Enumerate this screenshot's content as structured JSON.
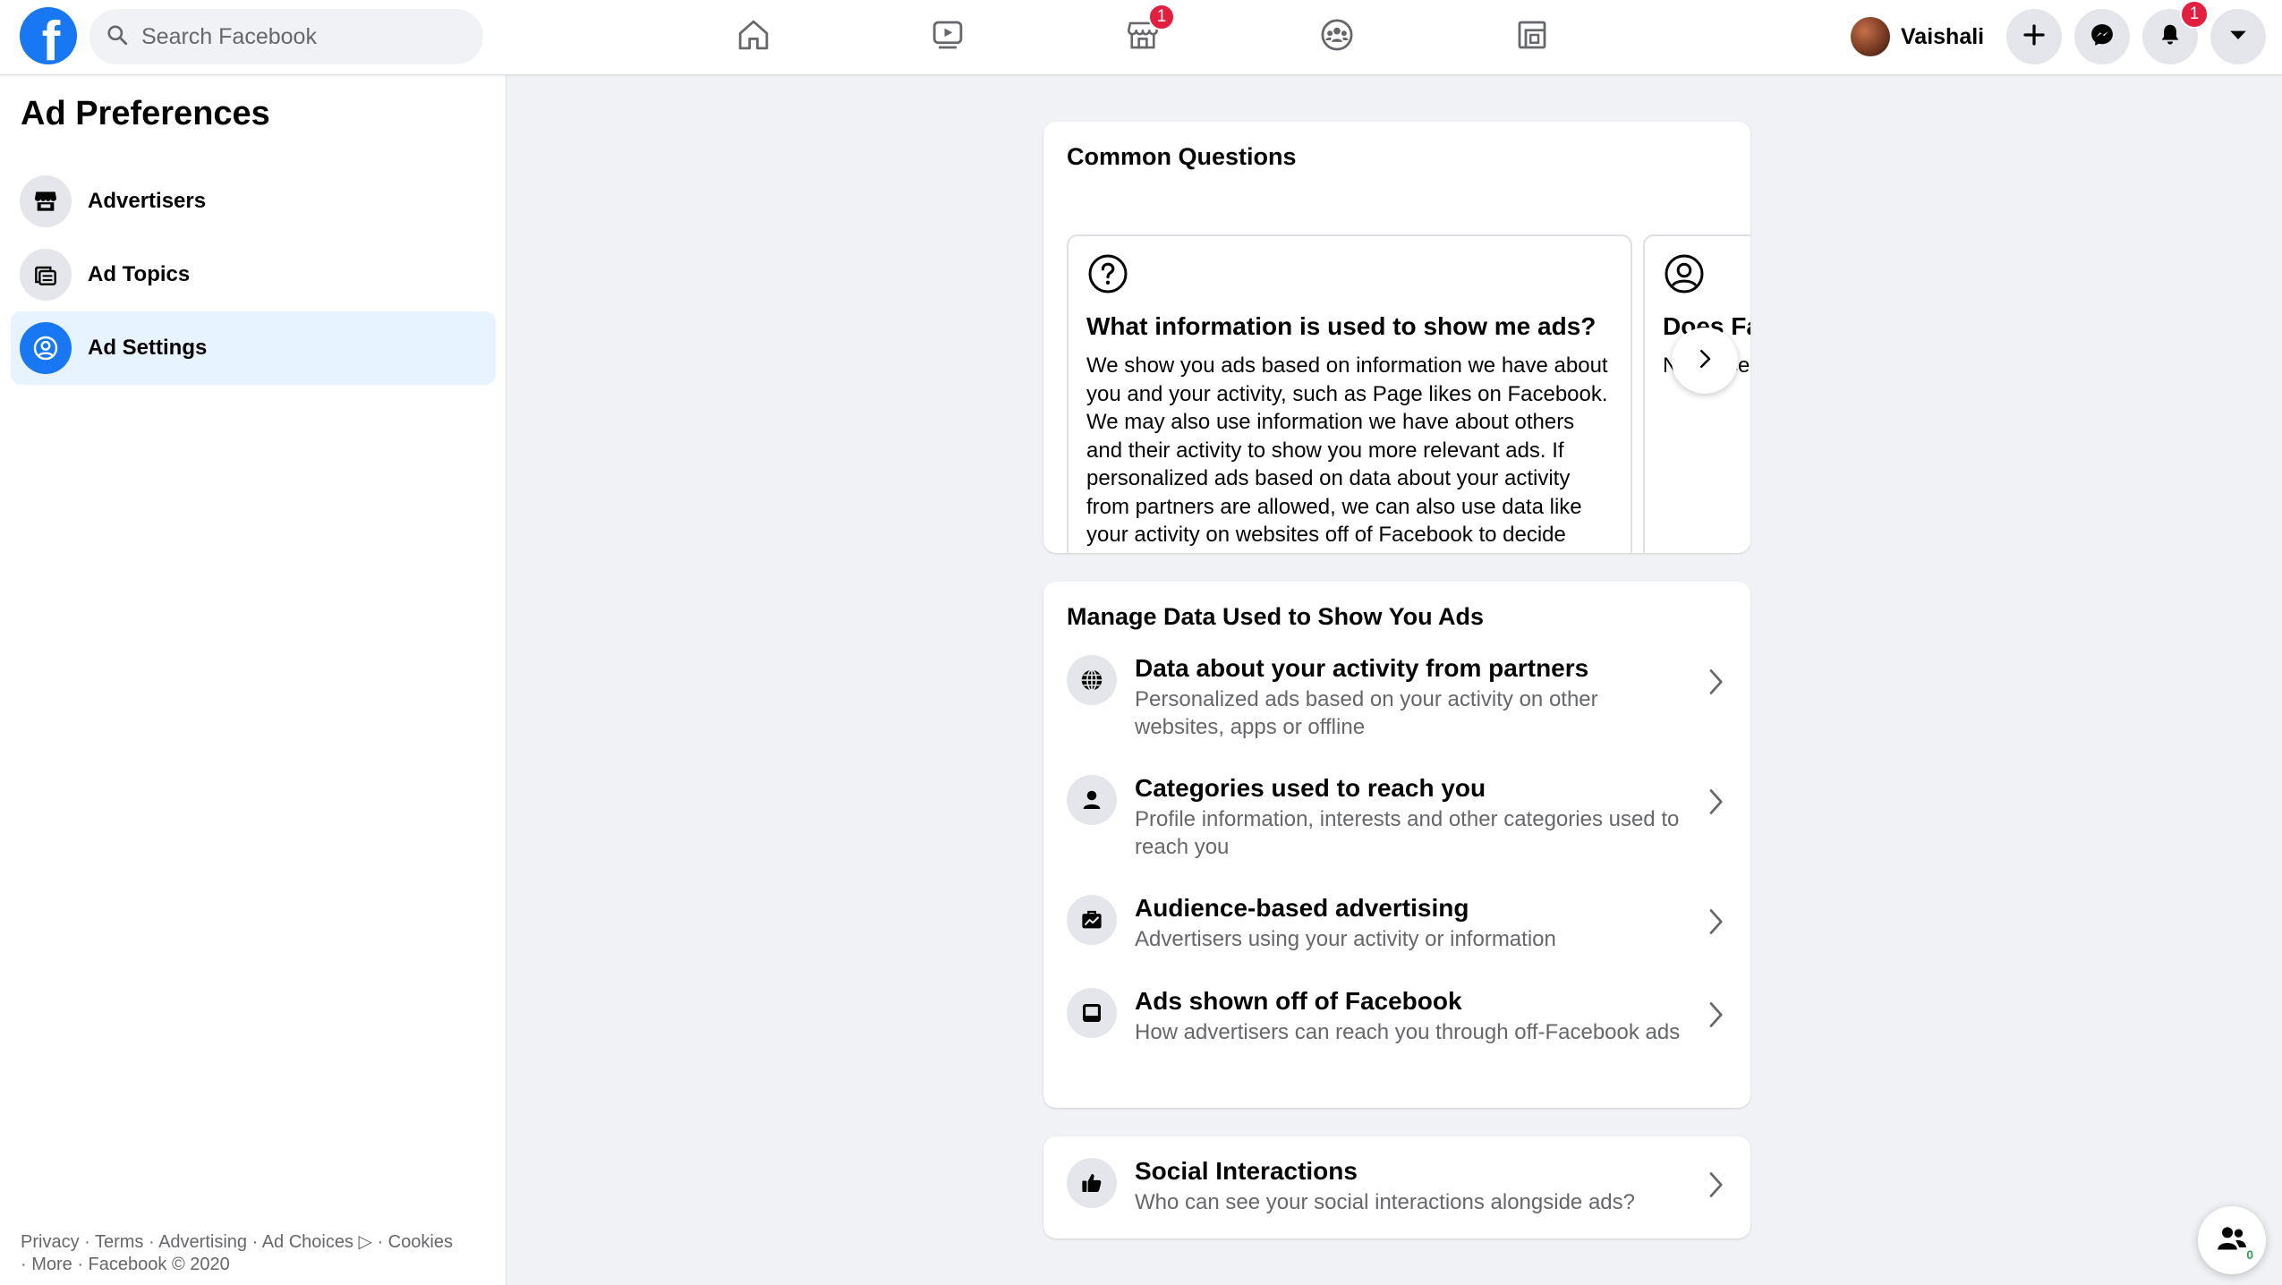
{
  "colors": {
    "brand": "#1877f2",
    "badge": "#e41e3f",
    "active_bg": "#e7f3ff",
    "secondary_text": "#65676b",
    "online": "#31a24c"
  },
  "topbar": {
    "logo_letter": "f",
    "search_placeholder": "Search Facebook",
    "nav": [
      {
        "name": "home",
        "icon": "home-icon"
      },
      {
        "name": "watch",
        "icon": "video-play-icon"
      },
      {
        "name": "marketplace",
        "icon": "store-icon",
        "badge": "1"
      },
      {
        "name": "groups",
        "icon": "groups-icon"
      },
      {
        "name": "gaming",
        "icon": "gaming-icon"
      }
    ],
    "profile_name": "Vaishali",
    "notifications_badge": "1",
    "actions": [
      "plus-icon",
      "messenger-icon",
      "bell-icon",
      "caret-down-icon"
    ]
  },
  "sidebar": {
    "title": "Ad Preferences",
    "items": [
      {
        "label": "Advertisers",
        "icon": "store-icon",
        "active": false
      },
      {
        "label": "Ad Topics",
        "icon": "topics-icon",
        "active": false
      },
      {
        "label": "Ad Settings",
        "icon": "user-circle-icon",
        "active": true
      }
    ],
    "footer_line1": "Privacy · Terms · Advertising · Ad Choices ▷ · Cookies",
    "footer_line2": "· More · Facebook © 2020"
  },
  "common_questions": {
    "title": "Common Questions",
    "cards": [
      {
        "icon": "question-circle-icon",
        "title": "What information is used to show me ads?",
        "body": "We show you ads based on information we have about you and your activity, such as Page likes on Facebook. We may also use information we have about others and their activity to show you more relevant ads. If personalized ads based on data about your activity from partners are allowed, we can also use data like your activity on websites off of Facebook to decide which ads to show you."
      },
      {
        "icon": "user-circle-icon",
        "title": "Does Fa",
        "body": "No, Facel pe l y ce"
      }
    ]
  },
  "manage_data": {
    "title": "Manage Data Used to Show You Ads",
    "rows": [
      {
        "icon": "globe-icon",
        "title": "Data about your activity from partners",
        "subtitle": "Personalized ads based on your activity on other websites, apps or offline"
      },
      {
        "icon": "person-icon",
        "title": "Categories used to reach you",
        "subtitle": "Profile information, interests and other categories used to reach you"
      },
      {
        "icon": "briefcase-chart-icon",
        "title": "Audience-based advertising",
        "subtitle": "Advertisers using your activity or information"
      },
      {
        "icon": "display-icon",
        "title": "Ads shown off of Facebook",
        "subtitle": "How advertisers can reach you through off-Facebook ads"
      }
    ]
  },
  "social": {
    "icon": "thumbs-up-icon",
    "title": "Social Interactions",
    "subtitle": "Who can see your social interactions alongside ads?"
  },
  "chat": {
    "online_count": "0"
  }
}
